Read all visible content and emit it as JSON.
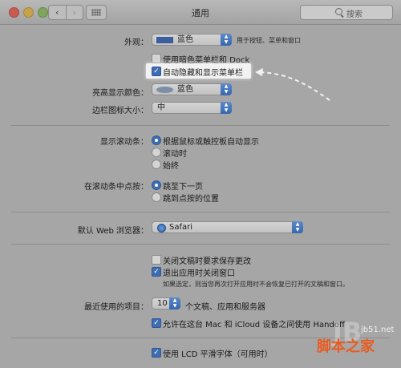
{
  "window": {
    "title": "通用"
  },
  "toolbar": {
    "back": "‹",
    "forward": "›",
    "search_placeholder": "搜索"
  },
  "appearance": {
    "label": "外观：",
    "value": "蓝色",
    "note": "用于按钮、菜单和窗口",
    "swatch_color": "#3a5f9e"
  },
  "dark_menu": {
    "label": "使用暗色菜单栏和 Dock",
    "checked": false
  },
  "auto_hide_menu": {
    "label": "自动隐藏和显示菜单栏",
    "checked": true
  },
  "highlight_color": {
    "label": "亮高显示颜色：",
    "value": "蓝色",
    "swatch_color": "#7d8ea8"
  },
  "sidebar_icon_size": {
    "label": "边栏图标大小：",
    "value": "中"
  },
  "show_scroll_bars": {
    "label": "显示滚动条：",
    "options": [
      "根据鼠标或触控板自动显示",
      "滚动时",
      "始终"
    ],
    "selected_index": 0
  },
  "click_scroll_bar": {
    "label": "在滚动条中点按：",
    "options": [
      "跳至下一页",
      "跳到点按的位置"
    ],
    "selected_index": 0
  },
  "default_browser": {
    "label": "默认 Web 浏览器：",
    "value": "Safari"
  },
  "ask_save_changes": {
    "label": "关闭文稿时要求保存更改",
    "checked": false
  },
  "close_windows_on_quit": {
    "label": "退出应用时关闭窗口",
    "checked": true,
    "note": "如果选定，则当您再次打开应用时不会恢复已打开的文稿和窗口。"
  },
  "recent_items": {
    "label": "最近使用的项目：",
    "value": "10",
    "suffix": "个文稿、应用和服务器"
  },
  "handoff": {
    "label": "允许在这台 Mac 和 iCloud 设备之间使用 Handoff",
    "checked": true
  },
  "lcd_smoothing": {
    "label": "使用 LCD 平滑字体（可用时）",
    "checked": true
  },
  "watermark": {
    "site": "脚本之家",
    "url": "jb51.net"
  }
}
